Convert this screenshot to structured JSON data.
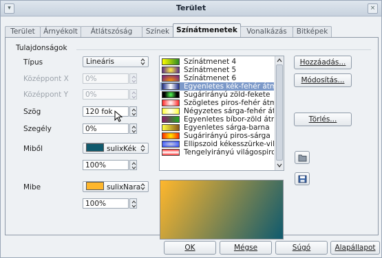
{
  "window": {
    "title": "Terület",
    "close_label": "×"
  },
  "tabs": [
    "Terület",
    "Árnyékolt",
    "Átlátszóság",
    "Színek",
    "Színátmenetek",
    "Vonalkázás",
    "Bitképek"
  ],
  "active_tab_index": 4,
  "section_title": "Tulajdonságok",
  "form": {
    "type_label": "Típus",
    "type_value": "Lineáris",
    "center_x_label": "Középpont X",
    "center_x_value": "0%",
    "center_y_label": "Középpont Y",
    "center_y_value": "0%",
    "angle_label": "Szög",
    "angle_value": "120 fok",
    "border_label": "Szegély",
    "border_value": "0%",
    "from_label": "Miből",
    "from_color_name": "sulixKék",
    "from_color_hex": "#0f5a6e",
    "from_intensity": "100%",
    "to_label": "Mibe",
    "to_color_name": "sulixNara",
    "to_color_hex": "#ffb72c",
    "to_intensity": "100%"
  },
  "gradients": [
    {
      "name": "Színátmenet 4",
      "c1": "#ffff00",
      "c2": "#2e8b22"
    },
    {
      "name": "Színátmenet 5",
      "c1": "#5a2a8a",
      "c2": "#ffee44"
    },
    {
      "name": "Színátmenet 6",
      "c1": "#6a1a8a",
      "c2": "#ff9900"
    },
    {
      "name": "Egyenletes kék-fehér átmenet",
      "c1": "#1e2e8a",
      "c2": "#ffffff"
    },
    {
      "name": "Sugárirányú zöld-fekete",
      "c1": "#55ff55",
      "c2": "#000000"
    },
    {
      "name": "Szögletes piros-fehér átmenet",
      "c1": "#ff2222",
      "c2": "#ffffff"
    },
    {
      "name": "Négyzetes sárga-fehér átmenet",
      "c1": "#ffff33",
      "c2": "#ffffff"
    },
    {
      "name": "Egyenletes bíbor-zöld átmenet",
      "c1": "#8a1a6a",
      "c2": "#22aa22"
    },
    {
      "name": "Egyenletes sárga-barna",
      "c1": "#ffff44",
      "c2": "#8a5a1a"
    },
    {
      "name": "Sugárirányú piros-sárga",
      "c1": "#ff2200",
      "c2": "#ffee00"
    },
    {
      "name": "Ellipszoid kékesszürke-világos",
      "c1": "#2244ff",
      "c2": "#ccccdd"
    },
    {
      "name": "Tengelyirányú világospiros-fehér",
      "c1": "#ff3333",
      "c2": "#ffffff"
    }
  ],
  "selected_gradient_index": 3,
  "buttons": {
    "add": "Hozzáadás...",
    "modify": "Módosítás...",
    "delete": "Törlés...",
    "ok": "OK",
    "cancel": "Mégse",
    "help": "Súgó",
    "reset": "Alapállapot"
  },
  "icons": {
    "load": "folder-open-icon",
    "save": "save-icon"
  }
}
